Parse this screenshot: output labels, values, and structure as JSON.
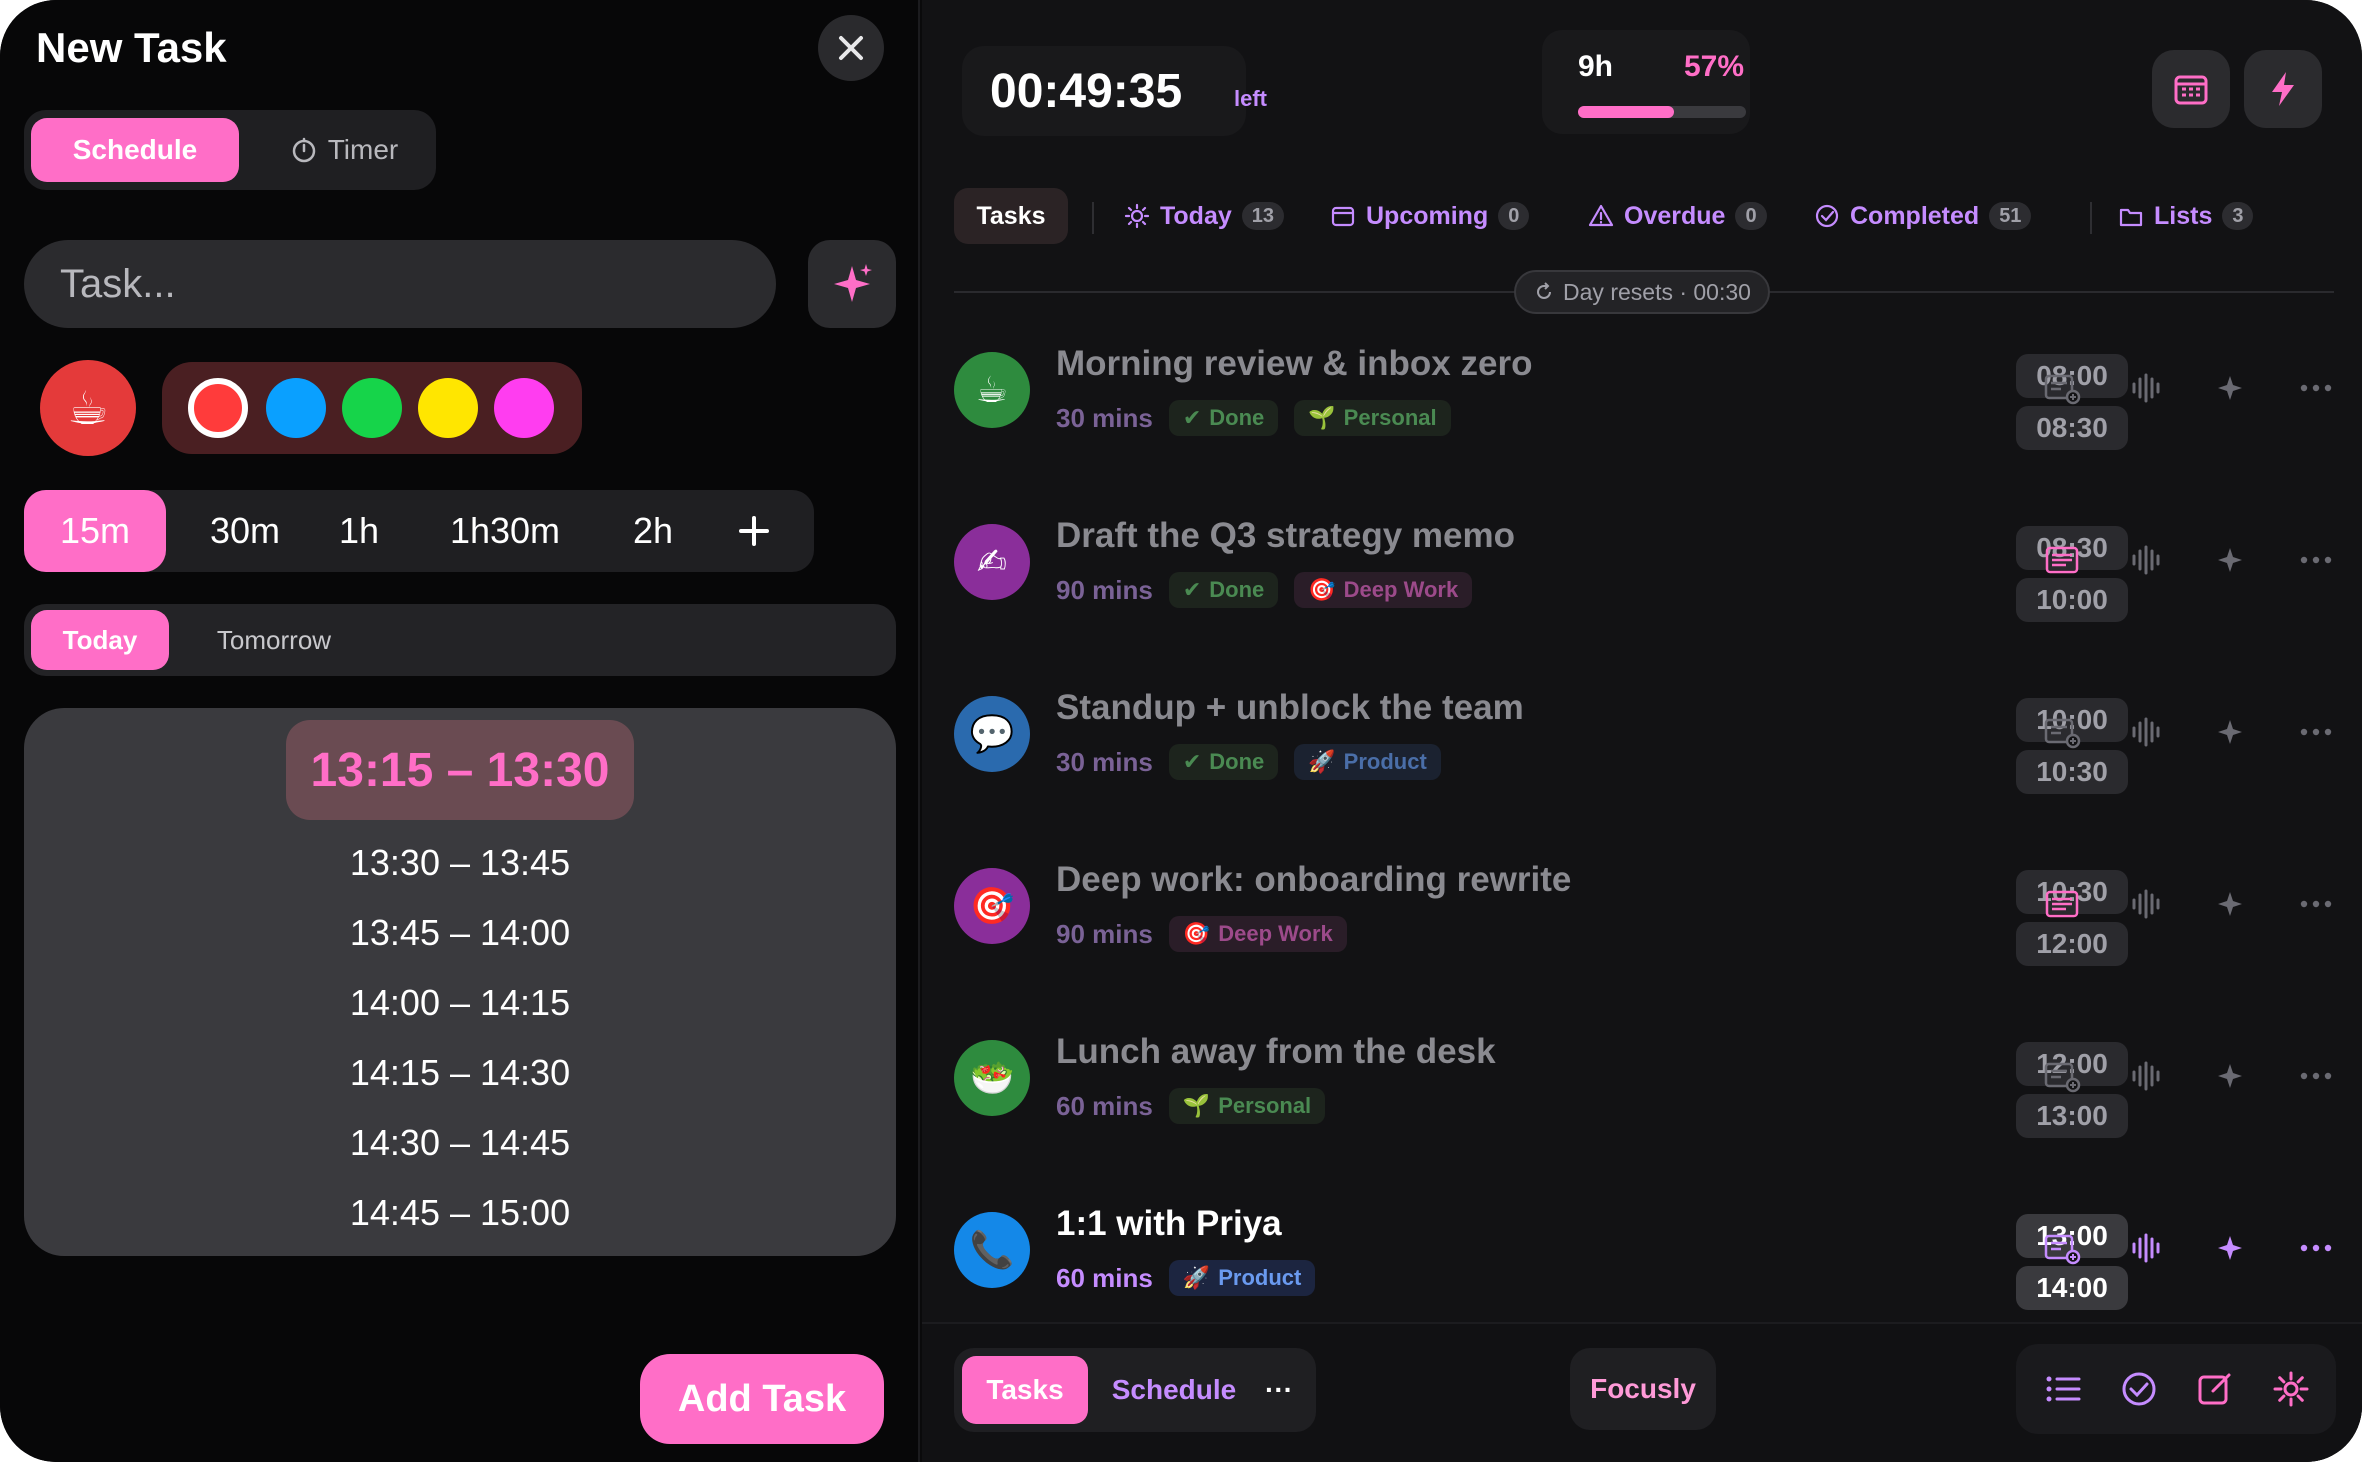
{
  "new_task": {
    "title": "New Task",
    "mode_tabs": {
      "schedule": "Schedule",
      "timer": "Timer"
    },
    "task_placeholder": "Task...",
    "emoji": "☕",
    "colors": [
      "#ff3b3b",
      "#0aa0ff",
      "#16d44a",
      "#ffe600",
      "#ff3df0"
    ],
    "selected_color": "#ff3b3b",
    "durations": [
      "15m",
      "30m",
      "1h",
      "1h30m",
      "2h"
    ],
    "selected_duration": "15m",
    "day_tabs": {
      "today": "Today",
      "tomorrow": "Tomorrow"
    },
    "selected_slot": "13:15 – 13:30",
    "slots": [
      "13:30 – 13:45",
      "13:45 – 14:00",
      "14:00 – 14:15",
      "14:15 – 14:30",
      "14:30 – 14:45",
      "14:45 – 15:00"
    ],
    "add_label": "Add Task"
  },
  "header": {
    "timer": "00:49:35",
    "timer_suffix": "left",
    "hours": "9h",
    "percent": "57%",
    "progress_fraction": 0.57
  },
  "tabs": {
    "tasks": "Tasks",
    "today": "Today",
    "today_count": "13",
    "upcoming": "Upcoming",
    "upcoming_count": "0",
    "overdue": "Overdue",
    "overdue_count": "0",
    "completed": "Completed",
    "completed_count": "51",
    "lists": "Lists",
    "lists_count": "3"
  },
  "day_resets": "Day resets · 00:30",
  "tasks": [
    {
      "title": "Morning review & inbox zero",
      "duration": "30 mins",
      "status": "Done",
      "tag": "Personal",
      "tag_emoji": "🌱",
      "avatar": "☕",
      "avatar_color": "#2e8b3e",
      "start": "08:00",
      "end": "08:30"
    },
    {
      "title": "Draft the Q3 strategy memo",
      "duration": "90 mins",
      "status": "Done",
      "tag": "Deep Work",
      "tag_emoji": "🎯",
      "avatar": "✍",
      "avatar_color": "#8a2e9a",
      "start": "08:30",
      "end": "10:00"
    },
    {
      "title": "Standup + unblock the team",
      "duration": "30 mins",
      "status": "Done",
      "tag": "Product",
      "tag_emoji": "🚀",
      "avatar": "💬",
      "avatar_color": "#2a6aae",
      "start": "10:00",
      "end": "10:30"
    },
    {
      "title": "Deep work: onboarding rewrite",
      "duration": "90 mins",
      "status": "",
      "tag": "Deep Work",
      "tag_emoji": "🎯",
      "avatar": "🎯",
      "avatar_color": "#8a2e9a",
      "start": "10:30",
      "end": "12:00"
    },
    {
      "title": "Lunch away from the desk",
      "duration": "60 mins",
      "status": "",
      "tag": "Personal",
      "tag_emoji": "🌱",
      "avatar": "🥗",
      "avatar_color": "#2e8b3e",
      "start": "12:00",
      "end": "13:00"
    },
    {
      "title": "1:1 with Priya",
      "duration": "60 mins",
      "status": "",
      "tag": "Product",
      "tag_emoji": "🚀",
      "avatar": "📞",
      "avatar_color": "#1488e8",
      "start": "13:00",
      "end": "14:00"
    }
  ],
  "bottom": {
    "tasks": "Tasks",
    "schedule": "Schedule",
    "more": "···",
    "brand": "Focusly"
  }
}
